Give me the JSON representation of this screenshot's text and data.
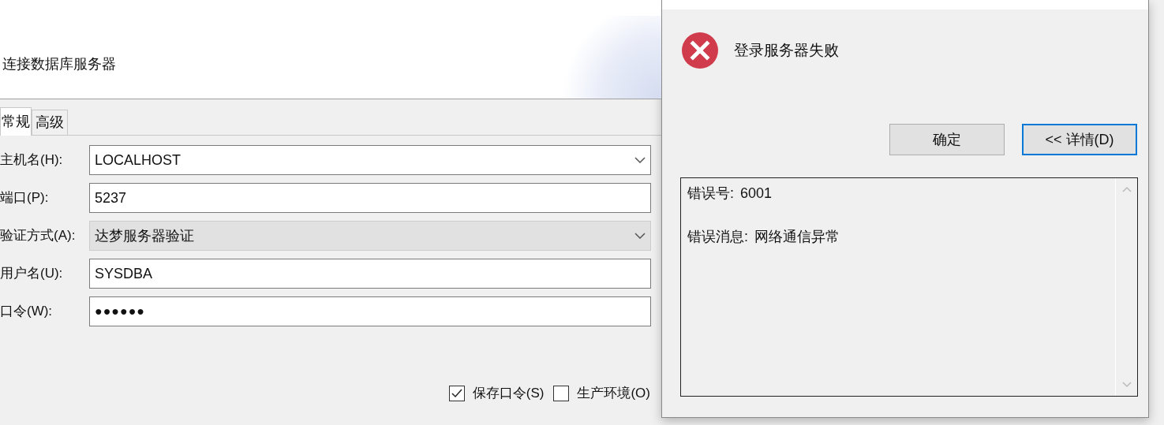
{
  "connect_window": {
    "title": "连接数据库服务器",
    "tabs": [
      {
        "label": "常规",
        "selected": true
      },
      {
        "label": "高级",
        "selected": false
      }
    ],
    "fields": [
      {
        "kind": "combo",
        "label": "主机名(H):",
        "value": "LOCALHOST",
        "disabled": false
      },
      {
        "kind": "text",
        "label": "端口(P):",
        "value": "5237",
        "disabled": false
      },
      {
        "kind": "combo",
        "label": "验证方式(A):",
        "value": "达梦服务器验证",
        "disabled": true
      },
      {
        "kind": "text",
        "label": "用户名(U):",
        "value": "SYSDBA",
        "disabled": false
      },
      {
        "kind": "password",
        "label": "口令(W):",
        "value": "●●●●●●",
        "disabled": false
      }
    ],
    "checkboxes": [
      {
        "label": "保存口令(S)",
        "checked": true
      },
      {
        "label": "生产环境(O)",
        "checked": false
      }
    ]
  },
  "error_dialog": {
    "message": "登录服务器失败",
    "buttons": [
      {
        "label": "确定",
        "focused": false
      },
      {
        "label": "<< 详情(D)",
        "focused": true
      }
    ],
    "details": [
      {
        "label": "错误号:",
        "value": "6001"
      },
      {
        "label": "错误消息:",
        "value": "网络通信异常"
      }
    ]
  }
}
